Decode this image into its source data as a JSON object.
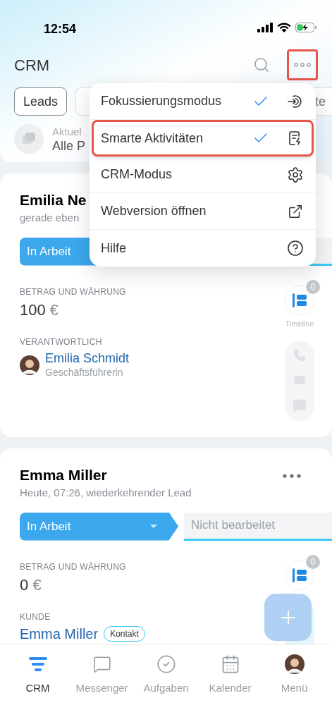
{
  "status_bar": {
    "time": "12:54"
  },
  "header": {
    "title": "CRM",
    "more_highlighted": true
  },
  "tabs": [
    {
      "label": "Leads",
      "selected": true
    },
    {
      "label": "te",
      "selected": false
    }
  ],
  "filter": {
    "label": "Aktuel",
    "value": "Alle P"
  },
  "menu": {
    "items": [
      {
        "label": "Fokussierungsmodus",
        "checked": true,
        "highlighted": false
      },
      {
        "label": "Smarte Aktivitäten",
        "checked": true,
        "highlighted": true
      },
      {
        "label": "CRM-Modus",
        "checked": false,
        "highlighted": false
      },
      {
        "label": "Webversion öffnen",
        "checked": false,
        "highlighted": false
      },
      {
        "label": "Hilfe",
        "checked": false,
        "highlighted": false
      }
    ]
  },
  "cards": [
    {
      "title": "Emilia Ne",
      "subtitle": "gerade eben",
      "stage": "In Arbeit",
      "timeline_count": "0",
      "timeline_label": "Timeline",
      "fields": [
        {
          "kind": "amount",
          "label": "BETRAG UND WÄHRUNG",
          "amount": "100",
          "currency": "€"
        },
        {
          "kind": "person",
          "label": "VERANTWORTLICH",
          "name": "Emilia Schmidt",
          "role": "Geschäftsführerin"
        }
      ]
    },
    {
      "title": "Emma Miller",
      "subtitle": "Heute, 07:26, wiederkehrender Lead",
      "stage": "In Arbeit",
      "next_stage": "Nicht bearbeitet",
      "show_more": true,
      "timeline_count": "0",
      "fields": [
        {
          "kind": "amount",
          "label": "BETRAG UND WÄHRUNG",
          "amount": "0",
          "currency": "€"
        },
        {
          "kind": "client",
          "label": "KUNDE",
          "name": "Emma Miller",
          "tag": "Kontakt"
        }
      ]
    }
  ],
  "nav": [
    {
      "label": "CRM",
      "selected": true
    },
    {
      "label": "Messenger",
      "selected": false
    },
    {
      "label": "Aufgaben",
      "selected": false
    },
    {
      "label": "Kalender",
      "selected": false
    },
    {
      "label": "Menü",
      "selected": false
    }
  ]
}
